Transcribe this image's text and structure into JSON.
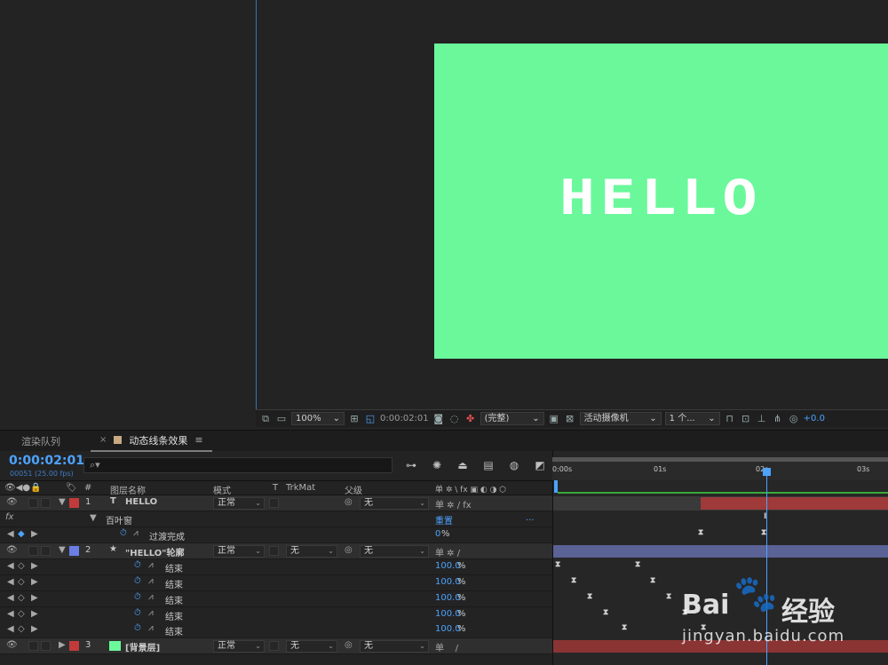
{
  "viewer": {
    "canvas_text": "HELLO",
    "canvas_color": "#6af89b",
    "toolbar": {
      "zoom": "100%",
      "timecode": "0:00:02:01",
      "resolution": "(完整)",
      "camera": "活动摄像机",
      "views": "1 个...",
      "exposure": "+0.0"
    }
  },
  "tabs": {
    "render_queue": "渲染队列",
    "close": "×",
    "comp": "动态线条效果",
    "menu": "≡"
  },
  "timeline": {
    "current_time": "0:00:02:01",
    "frame_info": "00051 (25.00 fps)",
    "search_icon": "⌕▾",
    "columns": {
      "num": "#",
      "layer_name": "图层名称",
      "mode": "模式",
      "t": "T",
      "trkmat": "TrkMat",
      "parent": "父级",
      "switches": "单 ✲ \\ fx ▣ ◐ ◑ ⬡"
    },
    "rows": [
      {
        "num": "1",
        "type_icon": "T",
        "name": "HELLO",
        "mode": "正常",
        "parent": "无",
        "color": "#c23b3b"
      },
      {
        "fx": "fx",
        "effect": "百叶窗",
        "reset": "重置",
        "dots": "..."
      },
      {
        "prop": "过渡完成",
        "value": "0",
        "unit": "%"
      },
      {
        "num": "2",
        "type_icon": "★",
        "name": "\"HELLO\"轮廓",
        "mode": "正常",
        "trkmat": "无",
        "parent": "无",
        "color": "#6a7ee6"
      },
      {
        "prop": "结束",
        "value": "100.0",
        "unit": "%"
      },
      {
        "prop": "结束",
        "value": "100.0",
        "unit": "%"
      },
      {
        "prop": "结束",
        "value": "100.0",
        "unit": "%"
      },
      {
        "prop": "结束",
        "value": "100.0",
        "unit": "%"
      },
      {
        "prop": "结束",
        "value": "100.0",
        "unit": "%"
      },
      {
        "num": "3",
        "name": "[背景层]",
        "mode": "正常",
        "trkmat": "无",
        "parent": "无",
        "color": "#c23b3b",
        "swatch": "#6af89b"
      }
    ],
    "ruler": [
      "0:00s",
      "01s",
      "02s",
      "03s"
    ]
  },
  "watermark": {
    "bai": "Bai",
    "du": "经验",
    "paw": "🐾",
    "url": "jingyan.baidu.com"
  }
}
